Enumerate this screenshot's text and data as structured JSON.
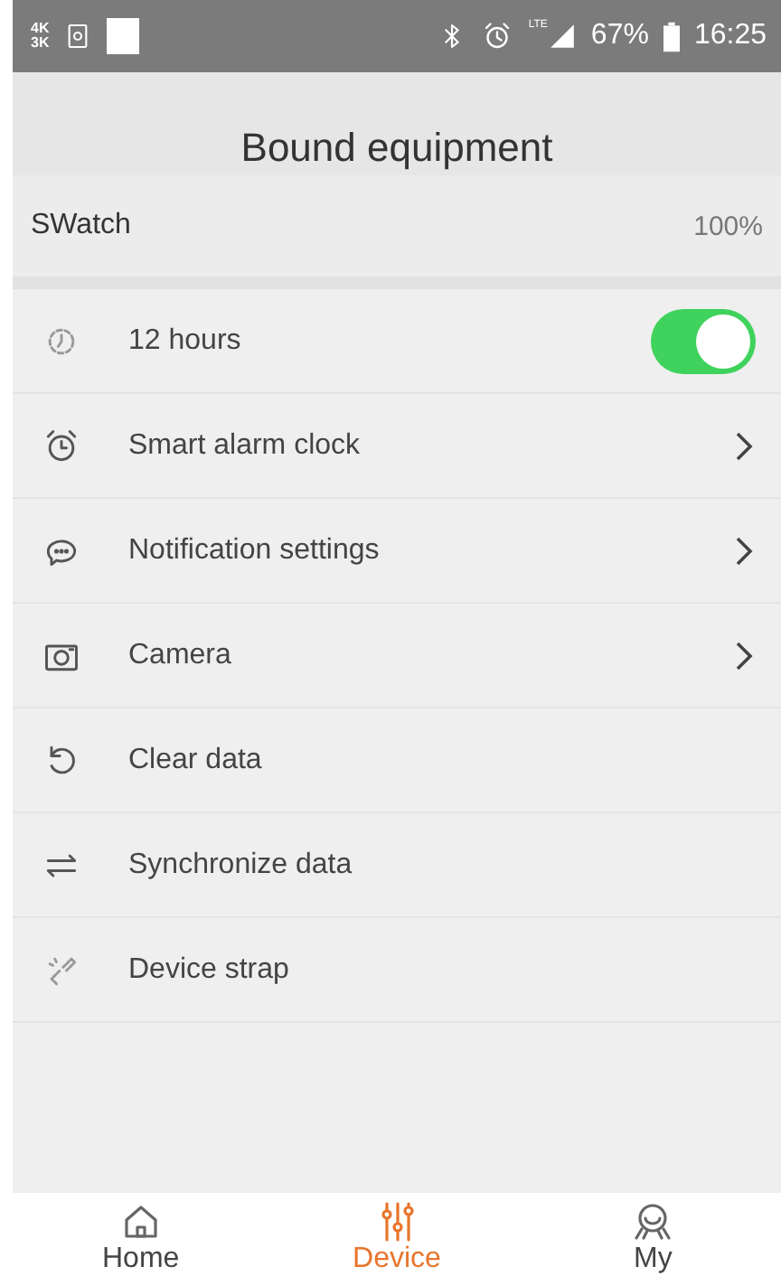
{
  "status_bar": {
    "badge_top": "4K",
    "badge_bottom": "3K",
    "network": "LTE",
    "battery": "67%",
    "time": "16:25"
  },
  "header": {
    "title": "Bound equipment"
  },
  "device": {
    "name": "SWatch",
    "battery": "100%"
  },
  "settings": [
    {
      "kind": "toggle",
      "label": "12 hours",
      "on": true
    },
    {
      "kind": "link",
      "label": "Smart alarm clock"
    },
    {
      "kind": "link",
      "label": "Notification settings"
    },
    {
      "kind": "link",
      "label": "Camera"
    },
    {
      "kind": "action",
      "label": "Clear data"
    },
    {
      "kind": "action",
      "label": "Synchronize data"
    },
    {
      "kind": "action",
      "label": "Device strap"
    }
  ],
  "nav": [
    {
      "label": "Home",
      "selected": false
    },
    {
      "label": "Device",
      "selected": true
    },
    {
      "label": "My",
      "selected": false
    }
  ]
}
